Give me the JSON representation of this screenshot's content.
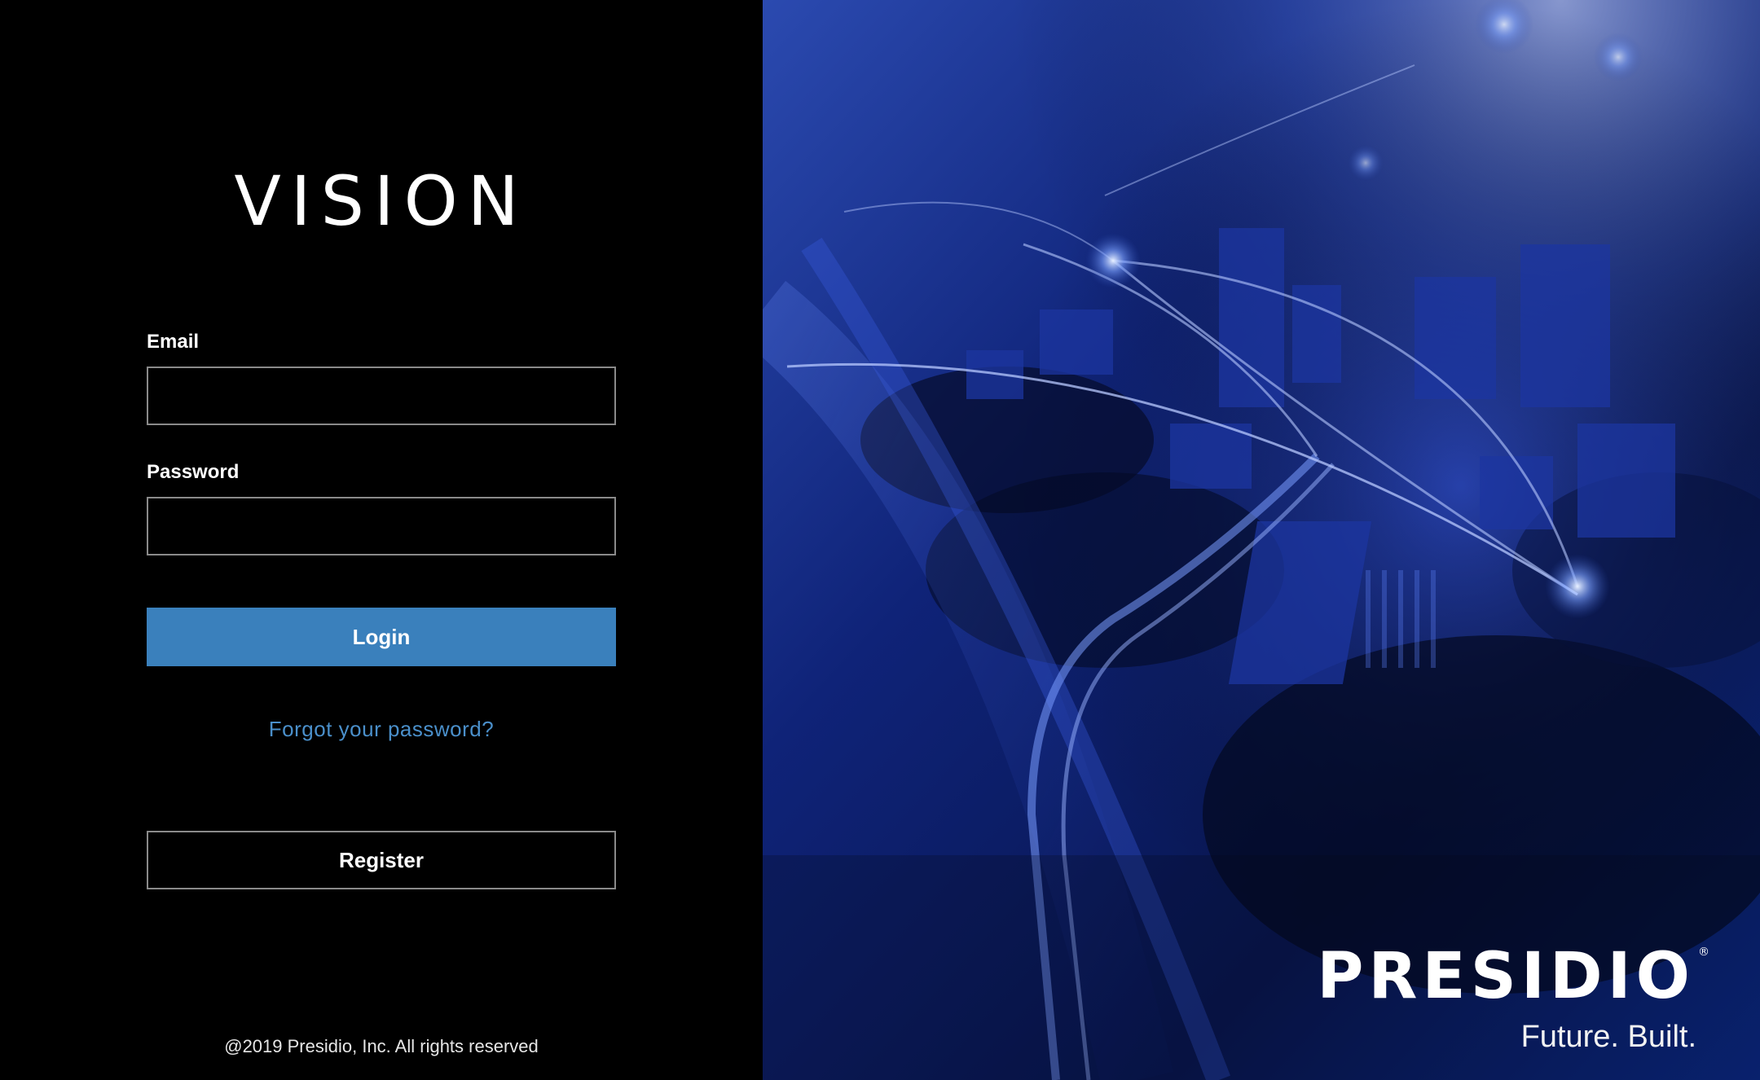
{
  "brand": {
    "name": "VISION"
  },
  "form": {
    "email_label": "Email",
    "email_value": "",
    "password_label": "Password",
    "password_value": "",
    "login_label": "Login",
    "forgot_label": "Forgot your password?",
    "register_label": "Register"
  },
  "footer": {
    "copyright": "@2019 Presidio, Inc. All rights reserved"
  },
  "hero": {
    "company": "PRESIDIO",
    "registered_mark": "®",
    "tagline": "Future. Built."
  },
  "colors": {
    "accent": "#3a80bc",
    "link": "#4a8fca",
    "left_background": "#000000",
    "hero_background": "#05154a"
  }
}
